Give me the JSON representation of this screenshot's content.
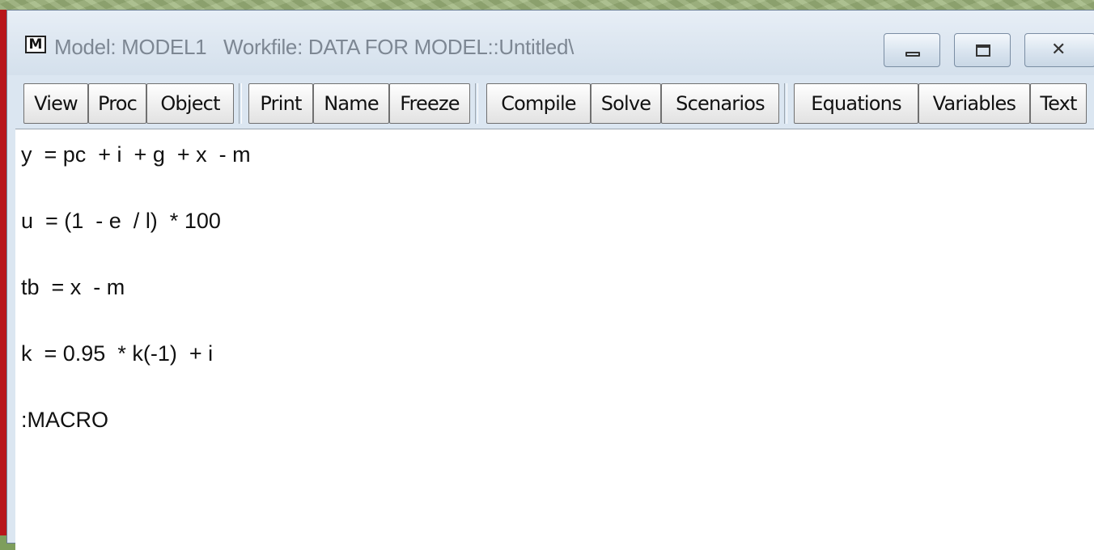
{
  "window": {
    "title": "Model: MODEL1   Workfile: DATA FOR MODEL::Untitled\\",
    "icon_letter": "M",
    "controls": {
      "minimize_icon": "minimize-icon",
      "maximize_icon": "maximize-icon",
      "close_icon": "close-icon",
      "close_glyph": "✕"
    }
  },
  "toolbar": {
    "view": "View",
    "proc": "Proc",
    "object": "Object",
    "print": "Print",
    "name": "Name",
    "freeze": "Freeze",
    "compile": "Compile",
    "solve": "Solve",
    "scenarios": "Scenarios",
    "equations": "Equations",
    "variables": "Variables",
    "text": "Text"
  },
  "model": {
    "lines": [
      "y  = pc  + i  + g  + x  - m",
      "u  = (1  - e  / l)  * 100",
      "tb  = x  - m",
      "k  = 0.95  * k(-1)  + i",
      ":MACRO"
    ]
  },
  "colors": {
    "background": "#7e9e5c",
    "window_frame": "#dbe6f1",
    "left_accent": "#b8151b",
    "title_text": "#7d8793"
  }
}
